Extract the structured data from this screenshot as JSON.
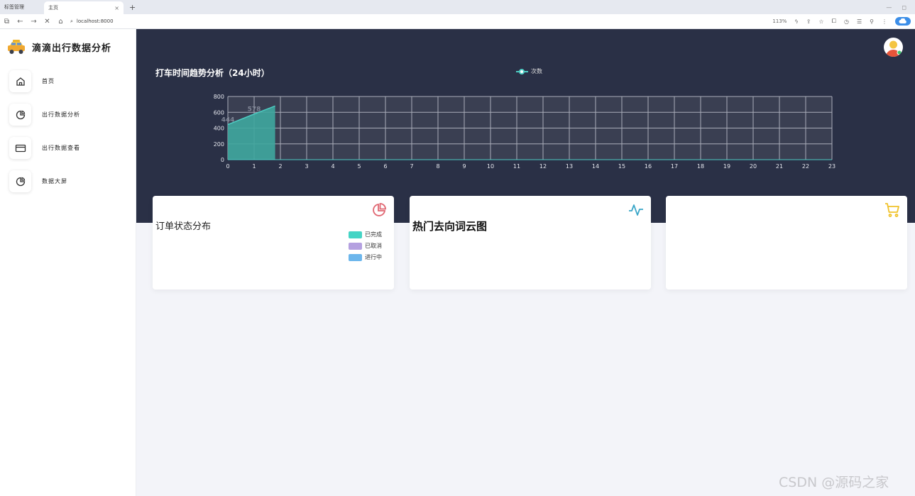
{
  "browser": {
    "tabs": [
      {
        "label": "标签管理"
      },
      {
        "label": "主页",
        "close": "×"
      }
    ],
    "new_tab": "+",
    "address": "localhost:8000",
    "zoom": "113%"
  },
  "sidebar": {
    "brand": "滴滴出行数据分析",
    "items": [
      {
        "label": "首页",
        "icon": "home-icon"
      },
      {
        "label": "出行数据分析",
        "icon": "pie-chart-icon"
      },
      {
        "label": "出行数据查看",
        "icon": "card-icon"
      },
      {
        "label": "数据大屏",
        "icon": "pie-chart-icon"
      }
    ]
  },
  "dashboard": {
    "chart_title": "打车时间趋势分析（24小时）",
    "legend_label": "次数",
    "cards": [
      {
        "title": "订单状态分布",
        "icon": "pie-chart-icon",
        "legend": [
          {
            "label": "已完成",
            "color": "#45d4c5"
          },
          {
            "label": "已取消",
            "color": "#b4a0e0"
          },
          {
            "label": "进行中",
            "color": "#6cb6ec"
          }
        ]
      },
      {
        "title": "热门去向词云图",
        "icon": "activity-icon"
      },
      {
        "title": "",
        "icon": "cart-icon"
      }
    ]
  },
  "chart_data": {
    "type": "area",
    "title": "打车时间趋势分析（24小时）",
    "legend": [
      "次数"
    ],
    "x": [
      0,
      1,
      2,
      3,
      4,
      5,
      6,
      7,
      8,
      9,
      10,
      11,
      12,
      13,
      14,
      15,
      16,
      17,
      18,
      19,
      20,
      21,
      22,
      23
    ],
    "x_rendered_points": [
      0,
      1.8
    ],
    "series": [
      {
        "name": "次数",
        "points": [
          [
            0,
            444
          ],
          [
            1,
            578
          ],
          [
            1.8,
            680
          ]
        ],
        "data_labels": [
          {
            "x": 0,
            "text": "444"
          },
          {
            "x": 1,
            "text": "578"
          }
        ]
      }
    ],
    "ylim": [
      0,
      800
    ],
    "yticks": [
      0,
      200,
      400,
      600,
      800
    ],
    "grid": true,
    "colors": {
      "area": "#3fa79e",
      "line": "#4ecdc4",
      "grid": "#a9adb9"
    }
  },
  "watermark": "CSDN @源码之家"
}
